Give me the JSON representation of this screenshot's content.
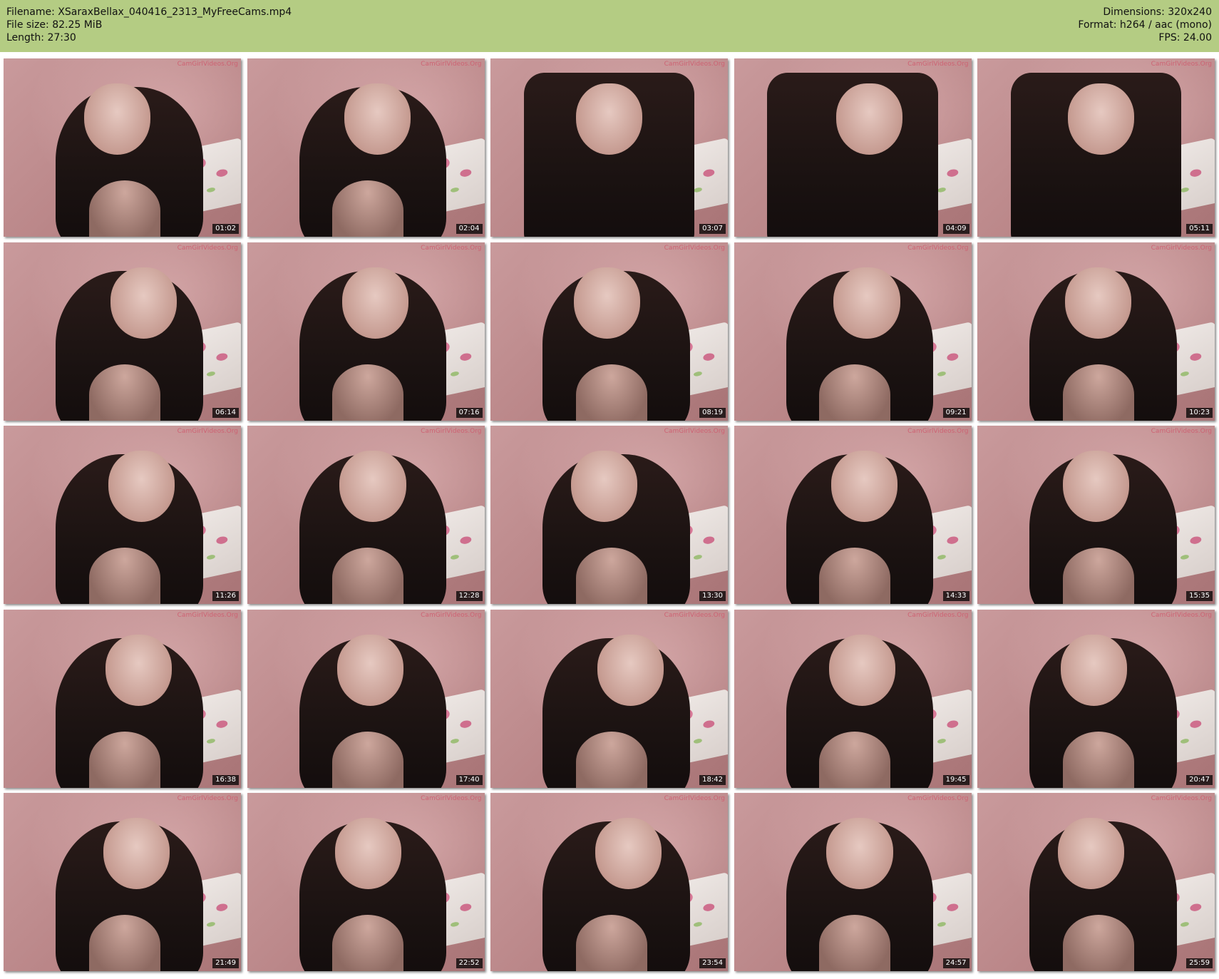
{
  "header": {
    "filename": "Filename: XSaraxBellax_040416_2313_MyFreeCams.mp4",
    "filesize": "File size: 82.25 MiB",
    "length": "Length: 27:30",
    "dimensions": "Dimensions: 320x240",
    "format": "Format: h264 / aac (mono)",
    "fps": "FPS: 24.00"
  },
  "watermark": "CamGirlVideos.Org",
  "thumbnails": [
    {
      "time": "01:02"
    },
    {
      "time": "02:04"
    },
    {
      "time": "03:07"
    },
    {
      "time": "04:09"
    },
    {
      "time": "05:11"
    },
    {
      "time": "06:14"
    },
    {
      "time": "07:16"
    },
    {
      "time": "08:19"
    },
    {
      "time": "09:21"
    },
    {
      "time": "10:23"
    },
    {
      "time": "11:26"
    },
    {
      "time": "12:28"
    },
    {
      "time": "13:30"
    },
    {
      "time": "14:33"
    },
    {
      "time": "15:35"
    },
    {
      "time": "16:38"
    },
    {
      "time": "17:40"
    },
    {
      "time": "18:42"
    },
    {
      "time": "19:45"
    },
    {
      "time": "20:47"
    },
    {
      "time": "21:49"
    },
    {
      "time": "22:52"
    },
    {
      "time": "23:54"
    },
    {
      "time": "24:57"
    },
    {
      "time": "25:59"
    }
  ]
}
